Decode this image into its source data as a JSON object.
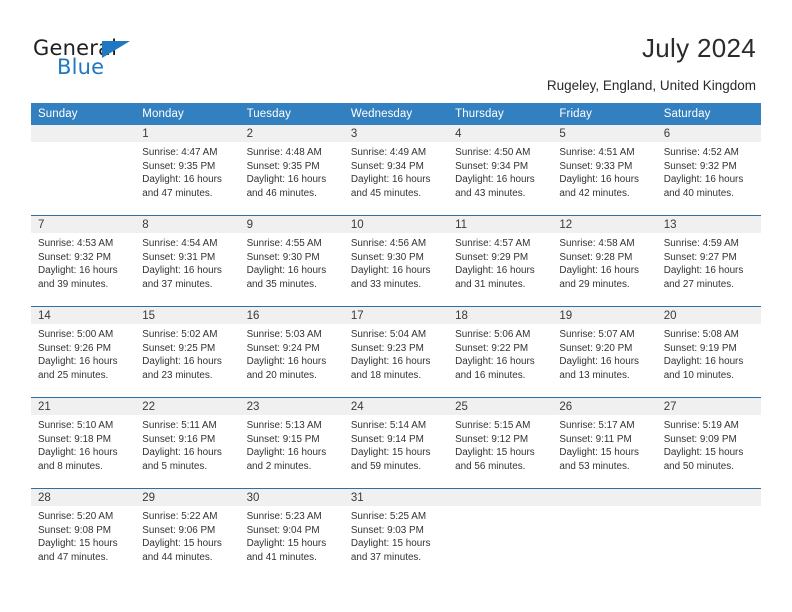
{
  "brand": {
    "name_part1": "General",
    "name_part2": "Blue",
    "triangle_icon": "triangle-icon",
    "accent_color": "#1f78c1"
  },
  "header": {
    "title": "July 2024",
    "subtitle": "Rugeley, England, United Kingdom"
  },
  "colors": {
    "header_row_bg": "#3280c0",
    "daynum_band_bg": "#f0f0f0",
    "row_separator": "#2f6fa8",
    "text": "#333333"
  },
  "calendar": {
    "weekday_headers": [
      "Sunday",
      "Monday",
      "Tuesday",
      "Wednesday",
      "Thursday",
      "Friday",
      "Saturday"
    ],
    "weeks": [
      [
        {
          "day": "",
          "empty": true,
          "sunrise": "",
          "sunset": "",
          "daylight_line1": "",
          "daylight_line2": ""
        },
        {
          "day": "1",
          "sunrise": "Sunrise: 4:47 AM",
          "sunset": "Sunset: 9:35 PM",
          "daylight_line1": "Daylight: 16 hours",
          "daylight_line2": "and 47 minutes."
        },
        {
          "day": "2",
          "sunrise": "Sunrise: 4:48 AM",
          "sunset": "Sunset: 9:35 PM",
          "daylight_line1": "Daylight: 16 hours",
          "daylight_line2": "and 46 minutes."
        },
        {
          "day": "3",
          "sunrise": "Sunrise: 4:49 AM",
          "sunset": "Sunset: 9:34 PM",
          "daylight_line1": "Daylight: 16 hours",
          "daylight_line2": "and 45 minutes."
        },
        {
          "day": "4",
          "sunrise": "Sunrise: 4:50 AM",
          "sunset": "Sunset: 9:34 PM",
          "daylight_line1": "Daylight: 16 hours",
          "daylight_line2": "and 43 minutes."
        },
        {
          "day": "5",
          "sunrise": "Sunrise: 4:51 AM",
          "sunset": "Sunset: 9:33 PM",
          "daylight_line1": "Daylight: 16 hours",
          "daylight_line2": "and 42 minutes."
        },
        {
          "day": "6",
          "sunrise": "Sunrise: 4:52 AM",
          "sunset": "Sunset: 9:32 PM",
          "daylight_line1": "Daylight: 16 hours",
          "daylight_line2": "and 40 minutes."
        }
      ],
      [
        {
          "day": "7",
          "sunrise": "Sunrise: 4:53 AM",
          "sunset": "Sunset: 9:32 PM",
          "daylight_line1": "Daylight: 16 hours",
          "daylight_line2": "and 39 minutes."
        },
        {
          "day": "8",
          "sunrise": "Sunrise: 4:54 AM",
          "sunset": "Sunset: 9:31 PM",
          "daylight_line1": "Daylight: 16 hours",
          "daylight_line2": "and 37 minutes."
        },
        {
          "day": "9",
          "sunrise": "Sunrise: 4:55 AM",
          "sunset": "Sunset: 9:30 PM",
          "daylight_line1": "Daylight: 16 hours",
          "daylight_line2": "and 35 minutes."
        },
        {
          "day": "10",
          "sunrise": "Sunrise: 4:56 AM",
          "sunset": "Sunset: 9:30 PM",
          "daylight_line1": "Daylight: 16 hours",
          "daylight_line2": "and 33 minutes."
        },
        {
          "day": "11",
          "sunrise": "Sunrise: 4:57 AM",
          "sunset": "Sunset: 9:29 PM",
          "daylight_line1": "Daylight: 16 hours",
          "daylight_line2": "and 31 minutes."
        },
        {
          "day": "12",
          "sunrise": "Sunrise: 4:58 AM",
          "sunset": "Sunset: 9:28 PM",
          "daylight_line1": "Daylight: 16 hours",
          "daylight_line2": "and 29 minutes."
        },
        {
          "day": "13",
          "sunrise": "Sunrise: 4:59 AM",
          "sunset": "Sunset: 9:27 PM",
          "daylight_line1": "Daylight: 16 hours",
          "daylight_line2": "and 27 minutes."
        }
      ],
      [
        {
          "day": "14",
          "sunrise": "Sunrise: 5:00 AM",
          "sunset": "Sunset: 9:26 PM",
          "daylight_line1": "Daylight: 16 hours",
          "daylight_line2": "and 25 minutes."
        },
        {
          "day": "15",
          "sunrise": "Sunrise: 5:02 AM",
          "sunset": "Sunset: 9:25 PM",
          "daylight_line1": "Daylight: 16 hours",
          "daylight_line2": "and 23 minutes."
        },
        {
          "day": "16",
          "sunrise": "Sunrise: 5:03 AM",
          "sunset": "Sunset: 9:24 PM",
          "daylight_line1": "Daylight: 16 hours",
          "daylight_line2": "and 20 minutes."
        },
        {
          "day": "17",
          "sunrise": "Sunrise: 5:04 AM",
          "sunset": "Sunset: 9:23 PM",
          "daylight_line1": "Daylight: 16 hours",
          "daylight_line2": "and 18 minutes."
        },
        {
          "day": "18",
          "sunrise": "Sunrise: 5:06 AM",
          "sunset": "Sunset: 9:22 PM",
          "daylight_line1": "Daylight: 16 hours",
          "daylight_line2": "and 16 minutes."
        },
        {
          "day": "19",
          "sunrise": "Sunrise: 5:07 AM",
          "sunset": "Sunset: 9:20 PM",
          "daylight_line1": "Daylight: 16 hours",
          "daylight_line2": "and 13 minutes."
        },
        {
          "day": "20",
          "sunrise": "Sunrise: 5:08 AM",
          "sunset": "Sunset: 9:19 PM",
          "daylight_line1": "Daylight: 16 hours",
          "daylight_line2": "and 10 minutes."
        }
      ],
      [
        {
          "day": "21",
          "sunrise": "Sunrise: 5:10 AM",
          "sunset": "Sunset: 9:18 PM",
          "daylight_line1": "Daylight: 16 hours",
          "daylight_line2": "and 8 minutes."
        },
        {
          "day": "22",
          "sunrise": "Sunrise: 5:11 AM",
          "sunset": "Sunset: 9:16 PM",
          "daylight_line1": "Daylight: 16 hours",
          "daylight_line2": "and 5 minutes."
        },
        {
          "day": "23",
          "sunrise": "Sunrise: 5:13 AM",
          "sunset": "Sunset: 9:15 PM",
          "daylight_line1": "Daylight: 16 hours",
          "daylight_line2": "and 2 minutes."
        },
        {
          "day": "24",
          "sunrise": "Sunrise: 5:14 AM",
          "sunset": "Sunset: 9:14 PM",
          "daylight_line1": "Daylight: 15 hours",
          "daylight_line2": "and 59 minutes."
        },
        {
          "day": "25",
          "sunrise": "Sunrise: 5:15 AM",
          "sunset": "Sunset: 9:12 PM",
          "daylight_line1": "Daylight: 15 hours",
          "daylight_line2": "and 56 minutes."
        },
        {
          "day": "26",
          "sunrise": "Sunrise: 5:17 AM",
          "sunset": "Sunset: 9:11 PM",
          "daylight_line1": "Daylight: 15 hours",
          "daylight_line2": "and 53 minutes."
        },
        {
          "day": "27",
          "sunrise": "Sunrise: 5:19 AM",
          "sunset": "Sunset: 9:09 PM",
          "daylight_line1": "Daylight: 15 hours",
          "daylight_line2": "and 50 minutes."
        }
      ],
      [
        {
          "day": "28",
          "sunrise": "Sunrise: 5:20 AM",
          "sunset": "Sunset: 9:08 PM",
          "daylight_line1": "Daylight: 15 hours",
          "daylight_line2": "and 47 minutes."
        },
        {
          "day": "29",
          "sunrise": "Sunrise: 5:22 AM",
          "sunset": "Sunset: 9:06 PM",
          "daylight_line1": "Daylight: 15 hours",
          "daylight_line2": "and 44 minutes."
        },
        {
          "day": "30",
          "sunrise": "Sunrise: 5:23 AM",
          "sunset": "Sunset: 9:04 PM",
          "daylight_line1": "Daylight: 15 hours",
          "daylight_line2": "and 41 minutes."
        },
        {
          "day": "31",
          "sunrise": "Sunrise: 5:25 AM",
          "sunset": "Sunset: 9:03 PM",
          "daylight_line1": "Daylight: 15 hours",
          "daylight_line2": "and 37 minutes."
        },
        {
          "day": "",
          "empty": true,
          "sunrise": "",
          "sunset": "",
          "daylight_line1": "",
          "daylight_line2": ""
        },
        {
          "day": "",
          "empty": true,
          "sunrise": "",
          "sunset": "",
          "daylight_line1": "",
          "daylight_line2": ""
        },
        {
          "day": "",
          "empty": true,
          "sunrise": "",
          "sunset": "",
          "daylight_line1": "",
          "daylight_line2": ""
        }
      ]
    ]
  }
}
